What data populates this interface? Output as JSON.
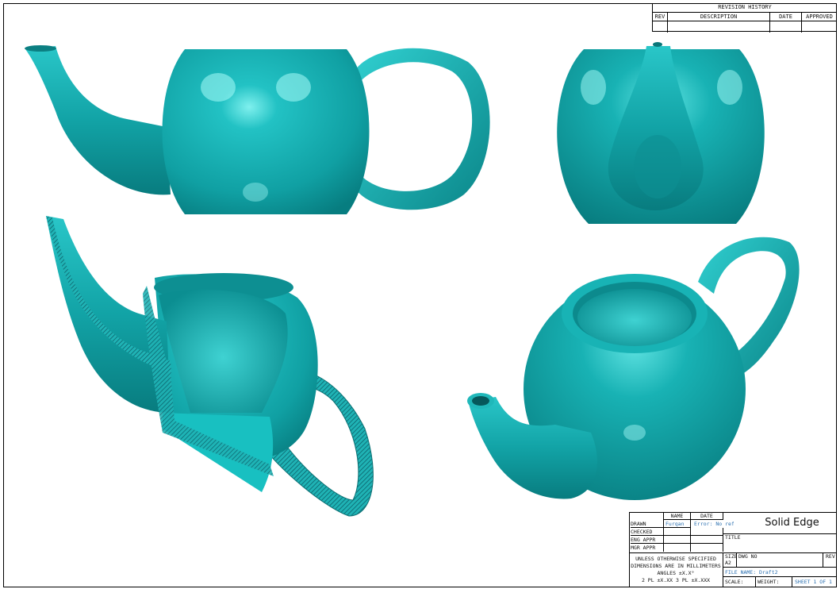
{
  "colors": {
    "body": "#12a3a6",
    "dark": "#066f73",
    "light": "#7ff0ee",
    "hatch": "#0b5c66"
  },
  "revision_history": {
    "title": "REVISION HISTORY",
    "columns": [
      "REV",
      "DESCRIPTION",
      "DATE",
      "APPROVED"
    ]
  },
  "title_block": {
    "name_header": "NAME",
    "date_header": "DATE",
    "rows": [
      {
        "label": "DRAWN",
        "name": "Furqan",
        "date": "Error: No reference"
      },
      {
        "label": "CHECKED",
        "name": "",
        "date": ""
      },
      {
        "label": "ENG APPR",
        "name": "",
        "date": ""
      },
      {
        "label": "MGR APPR",
        "name": "",
        "date": ""
      }
    ],
    "notes": [
      "UNLESS OTHERWISE SPECIFIED",
      "DIMENSIONS ARE IN MILLIMETERS",
      "ANGLES ±X.X°",
      "2 PL ±X.XX 3 PL ±X.XXX"
    ],
    "company": "Solid Edge",
    "title_label": "TITLE",
    "size_label": "SIZE",
    "size_value": "A2",
    "dwg_label": "DWG NO",
    "rev_label": "REV",
    "file_name": "FILE NAME: Draft2",
    "scale_label": "SCALE:",
    "weight_label": "WEIGHT:",
    "sheet_label": "SHEET 1 OF 1"
  }
}
